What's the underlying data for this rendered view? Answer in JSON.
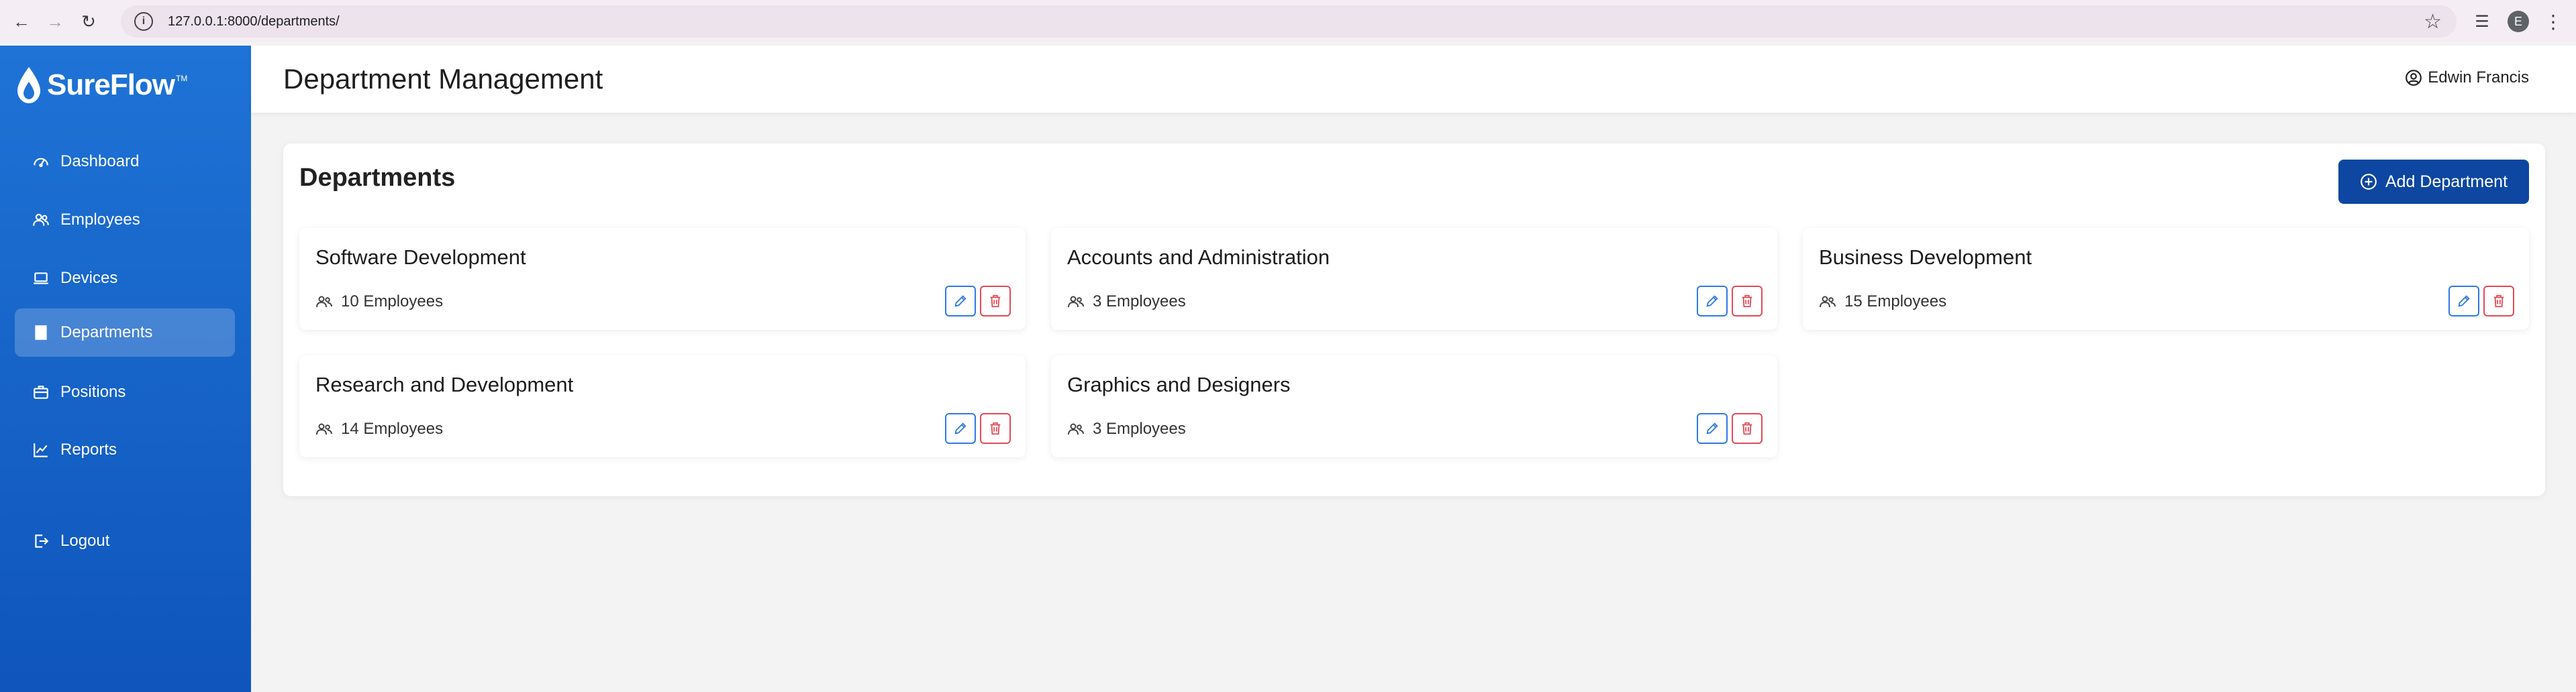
{
  "browser": {
    "url": "127.0.0.1:8000/departments/",
    "profile_initial": "E"
  },
  "brand": {
    "name": "SureFlow",
    "tm": "TM"
  },
  "sidebar": {
    "items": [
      {
        "label": "Dashboard",
        "icon": "gauge-icon"
      },
      {
        "label": "Employees",
        "icon": "people-icon"
      },
      {
        "label": "Devices",
        "icon": "laptop-icon"
      },
      {
        "label": "Departments",
        "icon": "building-icon",
        "active": true
      },
      {
        "label": "Positions",
        "icon": "briefcase-icon"
      },
      {
        "label": "Reports",
        "icon": "chart-line-icon"
      },
      {
        "label": "Logout",
        "icon": "logout-icon"
      }
    ]
  },
  "header": {
    "title": "Department Management",
    "user_name": "Edwin Francis"
  },
  "main": {
    "title": "Departments",
    "add_button_label": "Add Department",
    "departments": [
      {
        "name": "Software Development",
        "employees": "10 Employees"
      },
      {
        "name": "Accounts and Administration",
        "employees": "3 Employees"
      },
      {
        "name": "Business Development",
        "employees": "15 Employees"
      },
      {
        "name": "Research and Development",
        "employees": "14 Employees"
      },
      {
        "name": "Graphics and Designers",
        "employees": "3 Employees"
      }
    ]
  },
  "colors": {
    "sidebar_top": "#1f73d6",
    "sidebar_bottom": "#0f55bb",
    "primary_button": "#0d47a1",
    "edit_accent": "#2f7ae5",
    "delete_accent": "#e14b57"
  }
}
